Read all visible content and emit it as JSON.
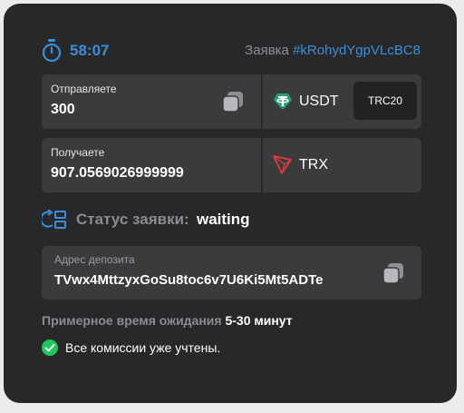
{
  "timer": {
    "value": "58:07"
  },
  "order": {
    "label": "Заявка",
    "id": "#kRohydYgpVLcBC8"
  },
  "send": {
    "label": "Отправляете",
    "amount": "300",
    "currency": "USDT",
    "network": "TRC20"
  },
  "receive": {
    "label": "Получаете",
    "amount": "907.0569026999999",
    "currency": "TRX"
  },
  "status": {
    "label": "Статус заявки:",
    "value": "waiting"
  },
  "deposit": {
    "label": "Адрес депозита",
    "address": "TVwx4MttzyxGoSu8toc6v7U6Ki5Mt5ADTe"
  },
  "wait": {
    "label": "Примерное время ожидания",
    "value": "5-30 минут"
  },
  "fees": {
    "text": "Все комиссии уже учтены."
  },
  "colors": {
    "accent": "#3b8fd8",
    "tether": "#26a17b",
    "tron": "#e3393a",
    "success": "#22c55e"
  }
}
